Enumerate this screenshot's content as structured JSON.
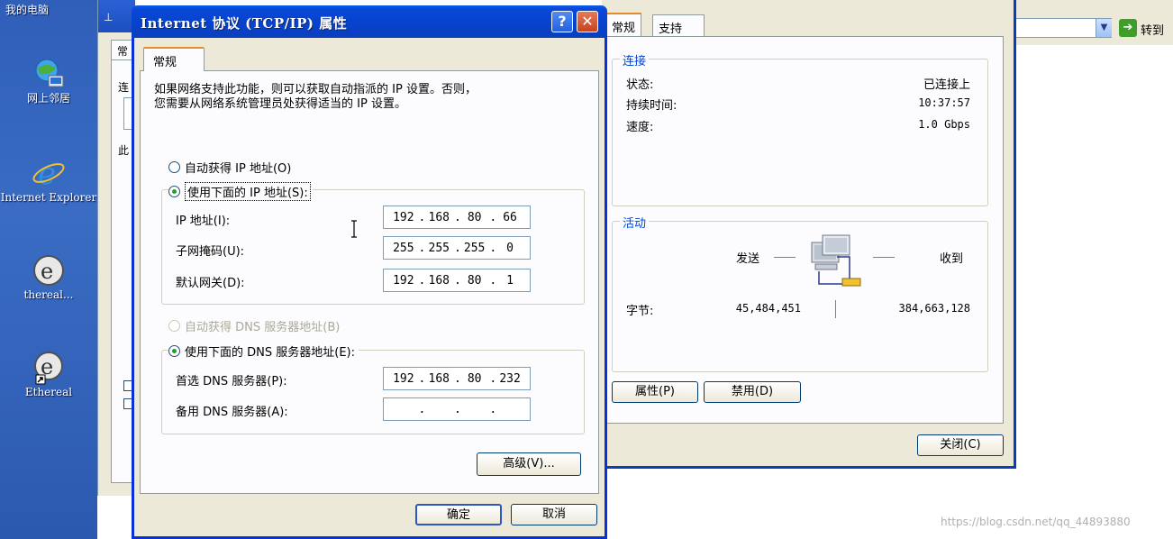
{
  "desktop": {
    "my_computer": "我的电脑",
    "network": "网上邻居",
    "ie": "Internet Explorer",
    "ethereal_short": "thereal...",
    "ethereal": "Ethereal"
  },
  "addressbar": {
    "go_label": "转到"
  },
  "bg_window": {
    "tab_label": "常",
    "side_char_1": "连",
    "side_char_2": "此"
  },
  "status_window": {
    "tabs": [
      {
        "label": "常规",
        "active": true
      },
      {
        "label": "支持",
        "active": false
      }
    ],
    "connection": {
      "title": "连接",
      "rows": [
        {
          "label": "状态:",
          "value": "已连接上"
        },
        {
          "label": "持续时间:",
          "value": "10:37:57"
        },
        {
          "label": "速度:",
          "value": "1.0 Gbps"
        }
      ]
    },
    "activity": {
      "title": "活动",
      "sent_label": "发送",
      "received_label": "收到",
      "bytes_label": "字节:",
      "bytes_sent": "45,484,451",
      "bytes_received": "384,663,128"
    },
    "buttons": {
      "properties": "属性(P)",
      "disable": "禁用(D)",
      "close": "关闭(C)"
    }
  },
  "tcpip_dialog": {
    "title": "Internet 协议 (TCP/IP) 属性",
    "help_btn": "?",
    "close_btn": "✕",
    "tab": "常规",
    "description_line1": "如果网络支持此功能，则可以获取自动指派的 IP 设置。否则，",
    "description_line2": "您需要从网络系统管理员处获得适当的 IP 设置。",
    "radio_auto_ip": "自动获得 IP 地址(O)",
    "radio_manual_ip": "使用下面的 IP 地址(S):",
    "ip_label": "IP 地址(I):",
    "ip_value": [
      "192",
      "168",
      "80",
      "66"
    ],
    "mask_label": "子网掩码(U):",
    "mask_value": [
      "255",
      "255",
      "255",
      "0"
    ],
    "gateway_label": "默认网关(D):",
    "gateway_value": [
      "192",
      "168",
      "80",
      "1"
    ],
    "radio_auto_dns": "自动获得 DNS 服务器地址(B)",
    "radio_manual_dns": "使用下面的 DNS 服务器地址(E):",
    "dns1_label": "首选 DNS 服务器(P):",
    "dns1_value": [
      "192",
      "168",
      "80",
      "232"
    ],
    "dns2_label": "备用 DNS 服务器(A):",
    "dns2_value": [
      "",
      "",
      "",
      ""
    ],
    "advanced_btn": "高级(V)...",
    "ok_btn": "确定",
    "cancel_btn": "取消"
  },
  "watermark": "https://blog.csdn.net/qq_44893880"
}
